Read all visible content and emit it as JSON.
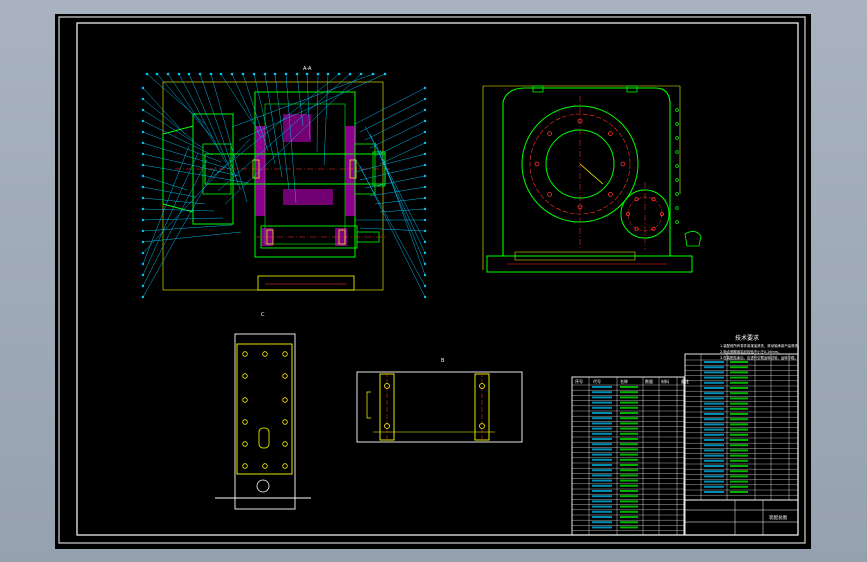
{
  "viewport": {
    "background": "#000000"
  },
  "colors": {
    "frame": "#ffffff",
    "geometry": "#00ff00",
    "annotation": "#ffff00",
    "leader": "#00c8ff",
    "hatch": "#ff00ff",
    "centerline": "#ff3030",
    "dimension": "#ff3030"
  },
  "views": {
    "section_view": {
      "name": "A-A"
    },
    "side_view": {
      "name": ""
    },
    "base_view": {
      "name": "C"
    },
    "plate_view": {
      "name": "B"
    }
  },
  "tech_requirements": {
    "title": "技术要求",
    "lines": [
      "1.装配前所有零件用煤油清洗，滚动轴承用汽油清洗。",
      "2.啮合侧隙用铅丝检验不小于0.16mm。",
      "3.在装配结束后，应进行空载运转试验，运转平稳。"
    ]
  },
  "parts_list": {
    "header": [
      "序号",
      "代号",
      "名称",
      "数量",
      "材料",
      "备注"
    ]
  },
  "title_block": {
    "drawing_name": "装配总图"
  }
}
